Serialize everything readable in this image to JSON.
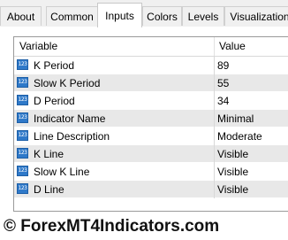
{
  "tabs": [
    {
      "label": "About"
    },
    {
      "label": "Common"
    },
    {
      "label": "Inputs"
    },
    {
      "label": "Colors"
    },
    {
      "label": "Levels"
    },
    {
      "label": "Visualization"
    }
  ],
  "active_tab": "Inputs",
  "table": {
    "columns": [
      "Variable",
      "Value"
    ],
    "rows": [
      {
        "icon": "123",
        "name": "K Period",
        "value": "89"
      },
      {
        "icon": "123",
        "name": "Slow K Period",
        "value": "55"
      },
      {
        "icon": "123",
        "name": "D Period",
        "value": "34"
      },
      {
        "icon": "123",
        "name": "Indicator Name",
        "value": "Minimal"
      },
      {
        "icon": "123",
        "name": "Line Description",
        "value": "Moderate"
      },
      {
        "icon": "123",
        "name": "K Line",
        "value": "Visible"
      },
      {
        "icon": "123",
        "name": "Slow K Line",
        "value": "Visible"
      },
      {
        "icon": "123",
        "name": "D Line",
        "value": "Visible"
      }
    ]
  },
  "watermark": "© ForexMT4Indicators.com",
  "colors": {
    "icon_bg": "#2f79c9",
    "alt_row": "#e8e8e8"
  }
}
